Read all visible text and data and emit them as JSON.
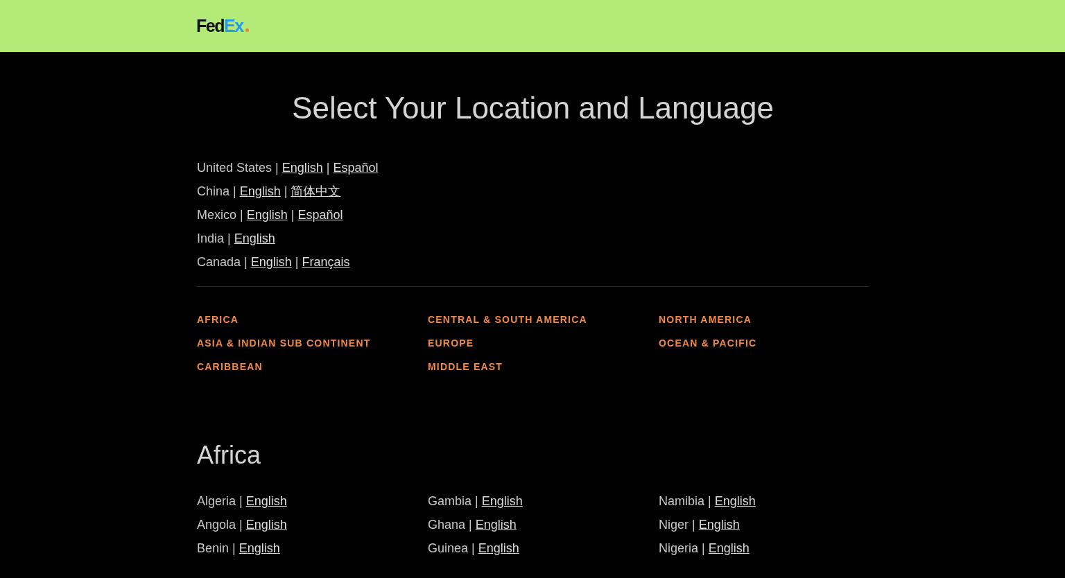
{
  "header": {
    "logo": [
      "Fed",
      "Ex"
    ]
  },
  "title": "Select Your Location and Language",
  "featured": [
    {
      "country": "United States |",
      "languages": [
        {
          "label": "English",
          "separator": "|"
        },
        {
          "label": "Español"
        }
      ]
    },
    {
      "country": "China |",
      "languages": [
        {
          "label": "English",
          "separator": "|"
        },
        {
          "label": "简体中文"
        }
      ]
    },
    {
      "country": "Mexico |",
      "languages": [
        {
          "label": "English",
          "separator": "|"
        },
        {
          "label": "Español"
        }
      ]
    },
    {
      "country": "India |",
      "languages": [
        {
          "label": "English"
        }
      ]
    },
    {
      "country": "Canada |",
      "languages": [
        {
          "label": "English",
          "separator": "|"
        },
        {
          "label": "Français"
        }
      ]
    }
  ],
  "regions": [
    [
      "AFRICA",
      "ASIA & INDIAN SUB CONTINENT",
      "CARIBBEAN"
    ],
    [
      "CENTRAL & SOUTH AMERICA",
      "EUROPE",
      "MIDDLE EAST"
    ],
    [
      "NORTH AMERICA",
      "OCEAN & PACIFIC"
    ]
  ],
  "section": {
    "heading": "Africa",
    "columns": [
      [
        {
          "country": "Algeria |",
          "languages": [
            {
              "label": "English"
            }
          ]
        },
        {
          "country": "Angola |",
          "languages": [
            {
              "label": "English"
            }
          ]
        },
        {
          "country": "Benin |",
          "languages": [
            {
              "label": "English"
            }
          ]
        }
      ],
      [
        {
          "country": "Gambia |",
          "languages": [
            {
              "label": "English"
            }
          ]
        },
        {
          "country": "Ghana |",
          "languages": [
            {
              "label": "English"
            }
          ]
        },
        {
          "country": "Guinea |",
          "languages": [
            {
              "label": "English"
            }
          ]
        }
      ],
      [
        {
          "country": "Namibia |",
          "languages": [
            {
              "label": "English"
            }
          ]
        },
        {
          "country": "Niger |",
          "languages": [
            {
              "label": "English"
            }
          ]
        },
        {
          "country": "Nigeria |",
          "languages": [
            {
              "label": "English"
            }
          ]
        }
      ]
    ]
  }
}
